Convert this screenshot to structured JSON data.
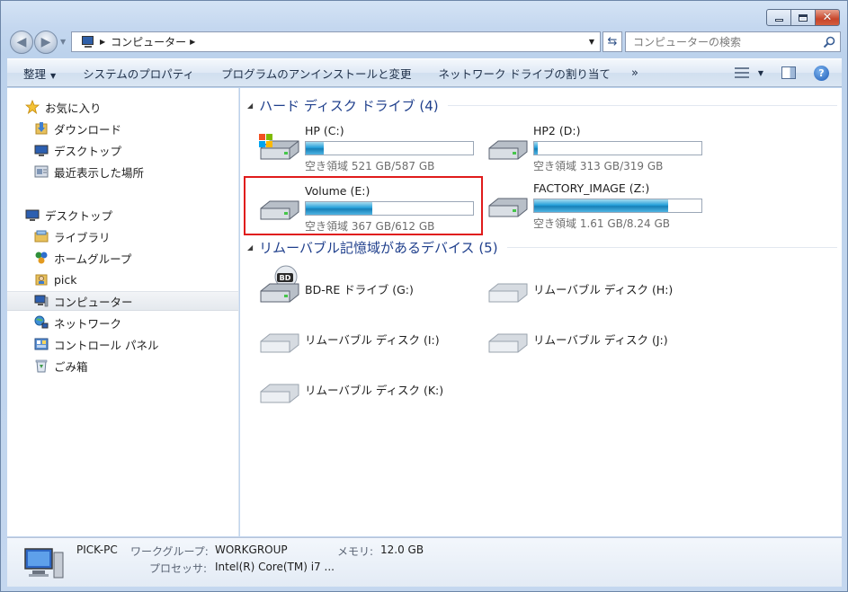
{
  "window": {
    "caption_buttons": [
      "minimize",
      "maximize",
      "close"
    ]
  },
  "address_bar": {
    "breadcrumb": "コンピューター",
    "search_placeholder": "コンピューターの検索"
  },
  "command_bar": {
    "items": [
      {
        "label": "整理",
        "has_dropdown": true
      },
      {
        "label": "システムのプロパティ"
      },
      {
        "label": "プログラムのアンインストールと変更"
      },
      {
        "label": "ネットワーク ドライブの割り当て"
      }
    ],
    "overflow": "»"
  },
  "nav_pane": {
    "favorites": [
      {
        "label": "お気に入り",
        "icon": "star-icon"
      },
      {
        "label": "ダウンロード",
        "icon": "downloads-folder-icon"
      },
      {
        "label": "デスクトップ",
        "icon": "desktop-icon"
      },
      {
        "label": "最近表示した場所",
        "icon": "recent-places-icon"
      }
    ],
    "tree": [
      {
        "label": "デスクトップ",
        "icon": "desktop-icon"
      },
      {
        "label": "ライブラリ",
        "icon": "libraries-icon"
      },
      {
        "label": "ホームグループ",
        "icon": "homegroup-icon"
      },
      {
        "label": "pick",
        "icon": "user-folder-icon"
      },
      {
        "label": "コンピューター",
        "icon": "computer-icon",
        "selected": true
      },
      {
        "label": "ネットワーク",
        "icon": "network-icon"
      },
      {
        "label": "コントロール パネル",
        "icon": "control-panel-icon"
      },
      {
        "label": "ごみ箱",
        "icon": "recycle-bin-icon"
      }
    ]
  },
  "hard_disks": {
    "header": "ハード ディスク ドライブ (4)",
    "drives": [
      {
        "name": "HP (C:)",
        "free": "空き領域 521 GB/587 GB",
        "used_fraction": 0.11,
        "icon": "windows-drive-icon"
      },
      {
        "name": "HP2 (D:)",
        "free": "空き領域 313 GB/319 GB",
        "used_fraction": 0.02,
        "icon": "hard-drive-icon"
      },
      {
        "name": "Volume (E:)",
        "free": "空き領域 367 GB/612 GB",
        "used_fraction": 0.4,
        "icon": "hard-drive-icon",
        "highlighted": true
      },
      {
        "name": "FACTORY_IMAGE (Z:)",
        "free": "空き領域 1.61 GB/8.24 GB",
        "used_fraction": 0.8,
        "icon": "hard-drive-icon"
      }
    ]
  },
  "removable": {
    "header": "リムーバブル記憶域があるデバイス (5)",
    "devices": [
      {
        "name": "BD-RE ドライブ (G:)",
        "icon": "bd-drive-icon",
        "badge": "BD"
      },
      {
        "name": "リムーバブル ディスク (H:)",
        "icon": "removable-disk-icon"
      },
      {
        "name": "リムーバブル ディスク (I:)",
        "icon": "removable-disk-icon"
      },
      {
        "name": "リムーバブル ディスク (J:)",
        "icon": "removable-disk-icon"
      },
      {
        "name": "リムーバブル ディスク (K:)",
        "icon": "removable-disk-icon"
      }
    ]
  },
  "details": {
    "pc_name": "PICK-PC",
    "workgroup_label": "ワークグループ:",
    "workgroup_value": "WORKGROUP",
    "memory_label": "メモリ:",
    "memory_value": "12.0 GB",
    "processor_label": "プロセッサ:",
    "processor_value": "Intel(R) Core(TM) i7 ..."
  }
}
